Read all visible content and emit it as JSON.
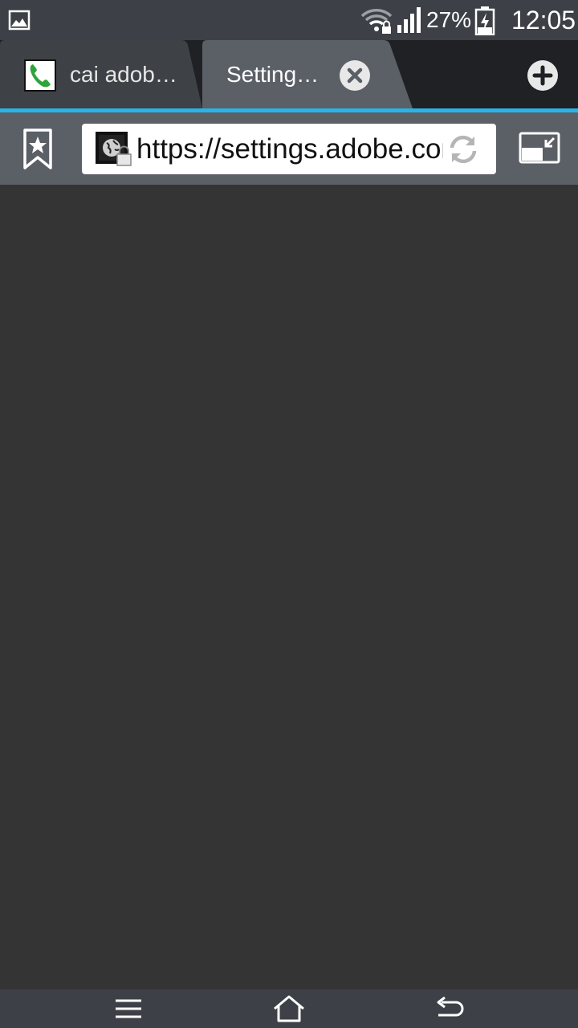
{
  "status_bar": {
    "battery_percent": "27%",
    "time": "12:05",
    "icons": [
      "gallery-icon",
      "wifi-lock-icon",
      "signal-icon",
      "battery-charging-icon"
    ]
  },
  "tabs": [
    {
      "title": "cai adob…",
      "favicon": "phone-icon",
      "active": false
    },
    {
      "title": "Setting…",
      "active": true
    }
  ],
  "toolbar": {
    "url": "https://settings.adobe.com",
    "icons": [
      "bookmark-star-icon",
      "secure-site-icon",
      "refresh-icon",
      "fullscreen-exit-icon"
    ]
  },
  "nav_bar": {
    "icons": [
      "menu-icon",
      "home-icon",
      "back-icon"
    ]
  },
  "colors": {
    "status_bar_bg": "#3d4046",
    "tab_strip_bg": "#1f2125",
    "tab_active_bg": "#5b5f66",
    "tab_inactive_bg": "#3e4146",
    "accent": "#2ab3e6",
    "content_bg": "#343434"
  }
}
